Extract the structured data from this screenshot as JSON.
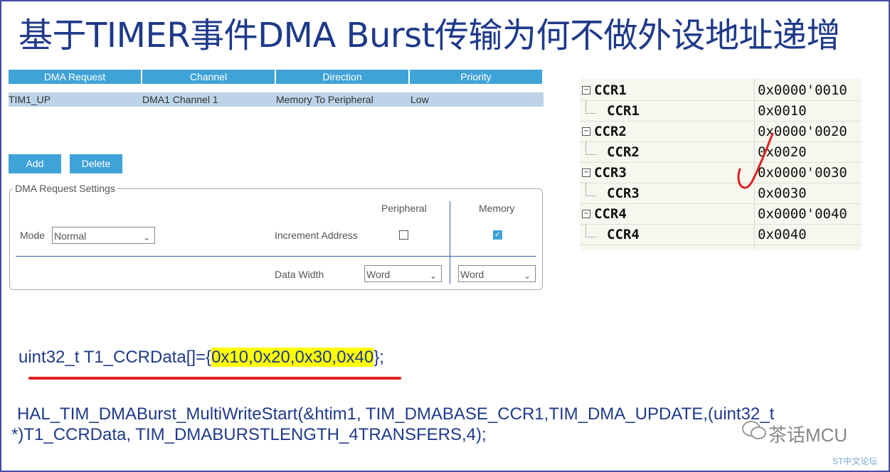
{
  "title": "基于TIMER事件DMA Burst传输为何不做外设地址递增",
  "dma_table": {
    "headers": [
      "DMA Request",
      "Channel",
      "Direction",
      "Priority"
    ],
    "row": [
      "TIM1_UP",
      "DMA1 Channel 1",
      "Memory To Peripheral",
      "Low"
    ]
  },
  "buttons": {
    "add": "Add",
    "delete": "Delete"
  },
  "settings": {
    "legend": "DMA Request Settings",
    "mode_label": "Mode",
    "mode_value": "Normal",
    "peripheral_label": "Peripheral",
    "memory_label": "Memory",
    "increment_label": "Increment Address",
    "peripheral_increment": false,
    "memory_increment": true,
    "data_width_label": "Data Width",
    "peripheral_width": "Word",
    "memory_width": "Word"
  },
  "registers": [
    {
      "name": "CCR1",
      "value": "0x0000'0010",
      "child": false
    },
    {
      "name": "CCR1",
      "value": "0x0010",
      "child": true
    },
    {
      "name": "CCR2",
      "value": "0x0000'0020",
      "child": false
    },
    {
      "name": "CCR2",
      "value": "0x0020",
      "child": true
    },
    {
      "name": "CCR3",
      "value": "0x0000'0030",
      "child": false
    },
    {
      "name": "CCR3",
      "value": "0x0030",
      "child": true
    },
    {
      "name": "CCR4",
      "value": "0x0000'0040",
      "child": false
    },
    {
      "name": "CCR4",
      "value": "0x0040",
      "child": true
    }
  ],
  "code": {
    "line1_prefix": "uint32_t T1_CCRData[]={",
    "line1_highlight": "0x10,0x20,0x30,0x40",
    "line1_suffix": "};",
    "line2": "HAL_TIM_DMABurst_MultiWriteStart(&htim1, TIM_DMABASE_CCR1,TIM_DMA_UPDATE,(uint32_t",
    "line3": "*)T1_CCRData, TIM_DMABURSTLENGTH_4TRANSFERS,4);"
  },
  "watermark": {
    "text": "茶话MCU",
    "sub": "ST中文论坛"
  },
  "colors": {
    "title": "#1f3a8a",
    "accent": "#3fa3d8",
    "highlight": "#ffff00",
    "red": "#e02020"
  }
}
